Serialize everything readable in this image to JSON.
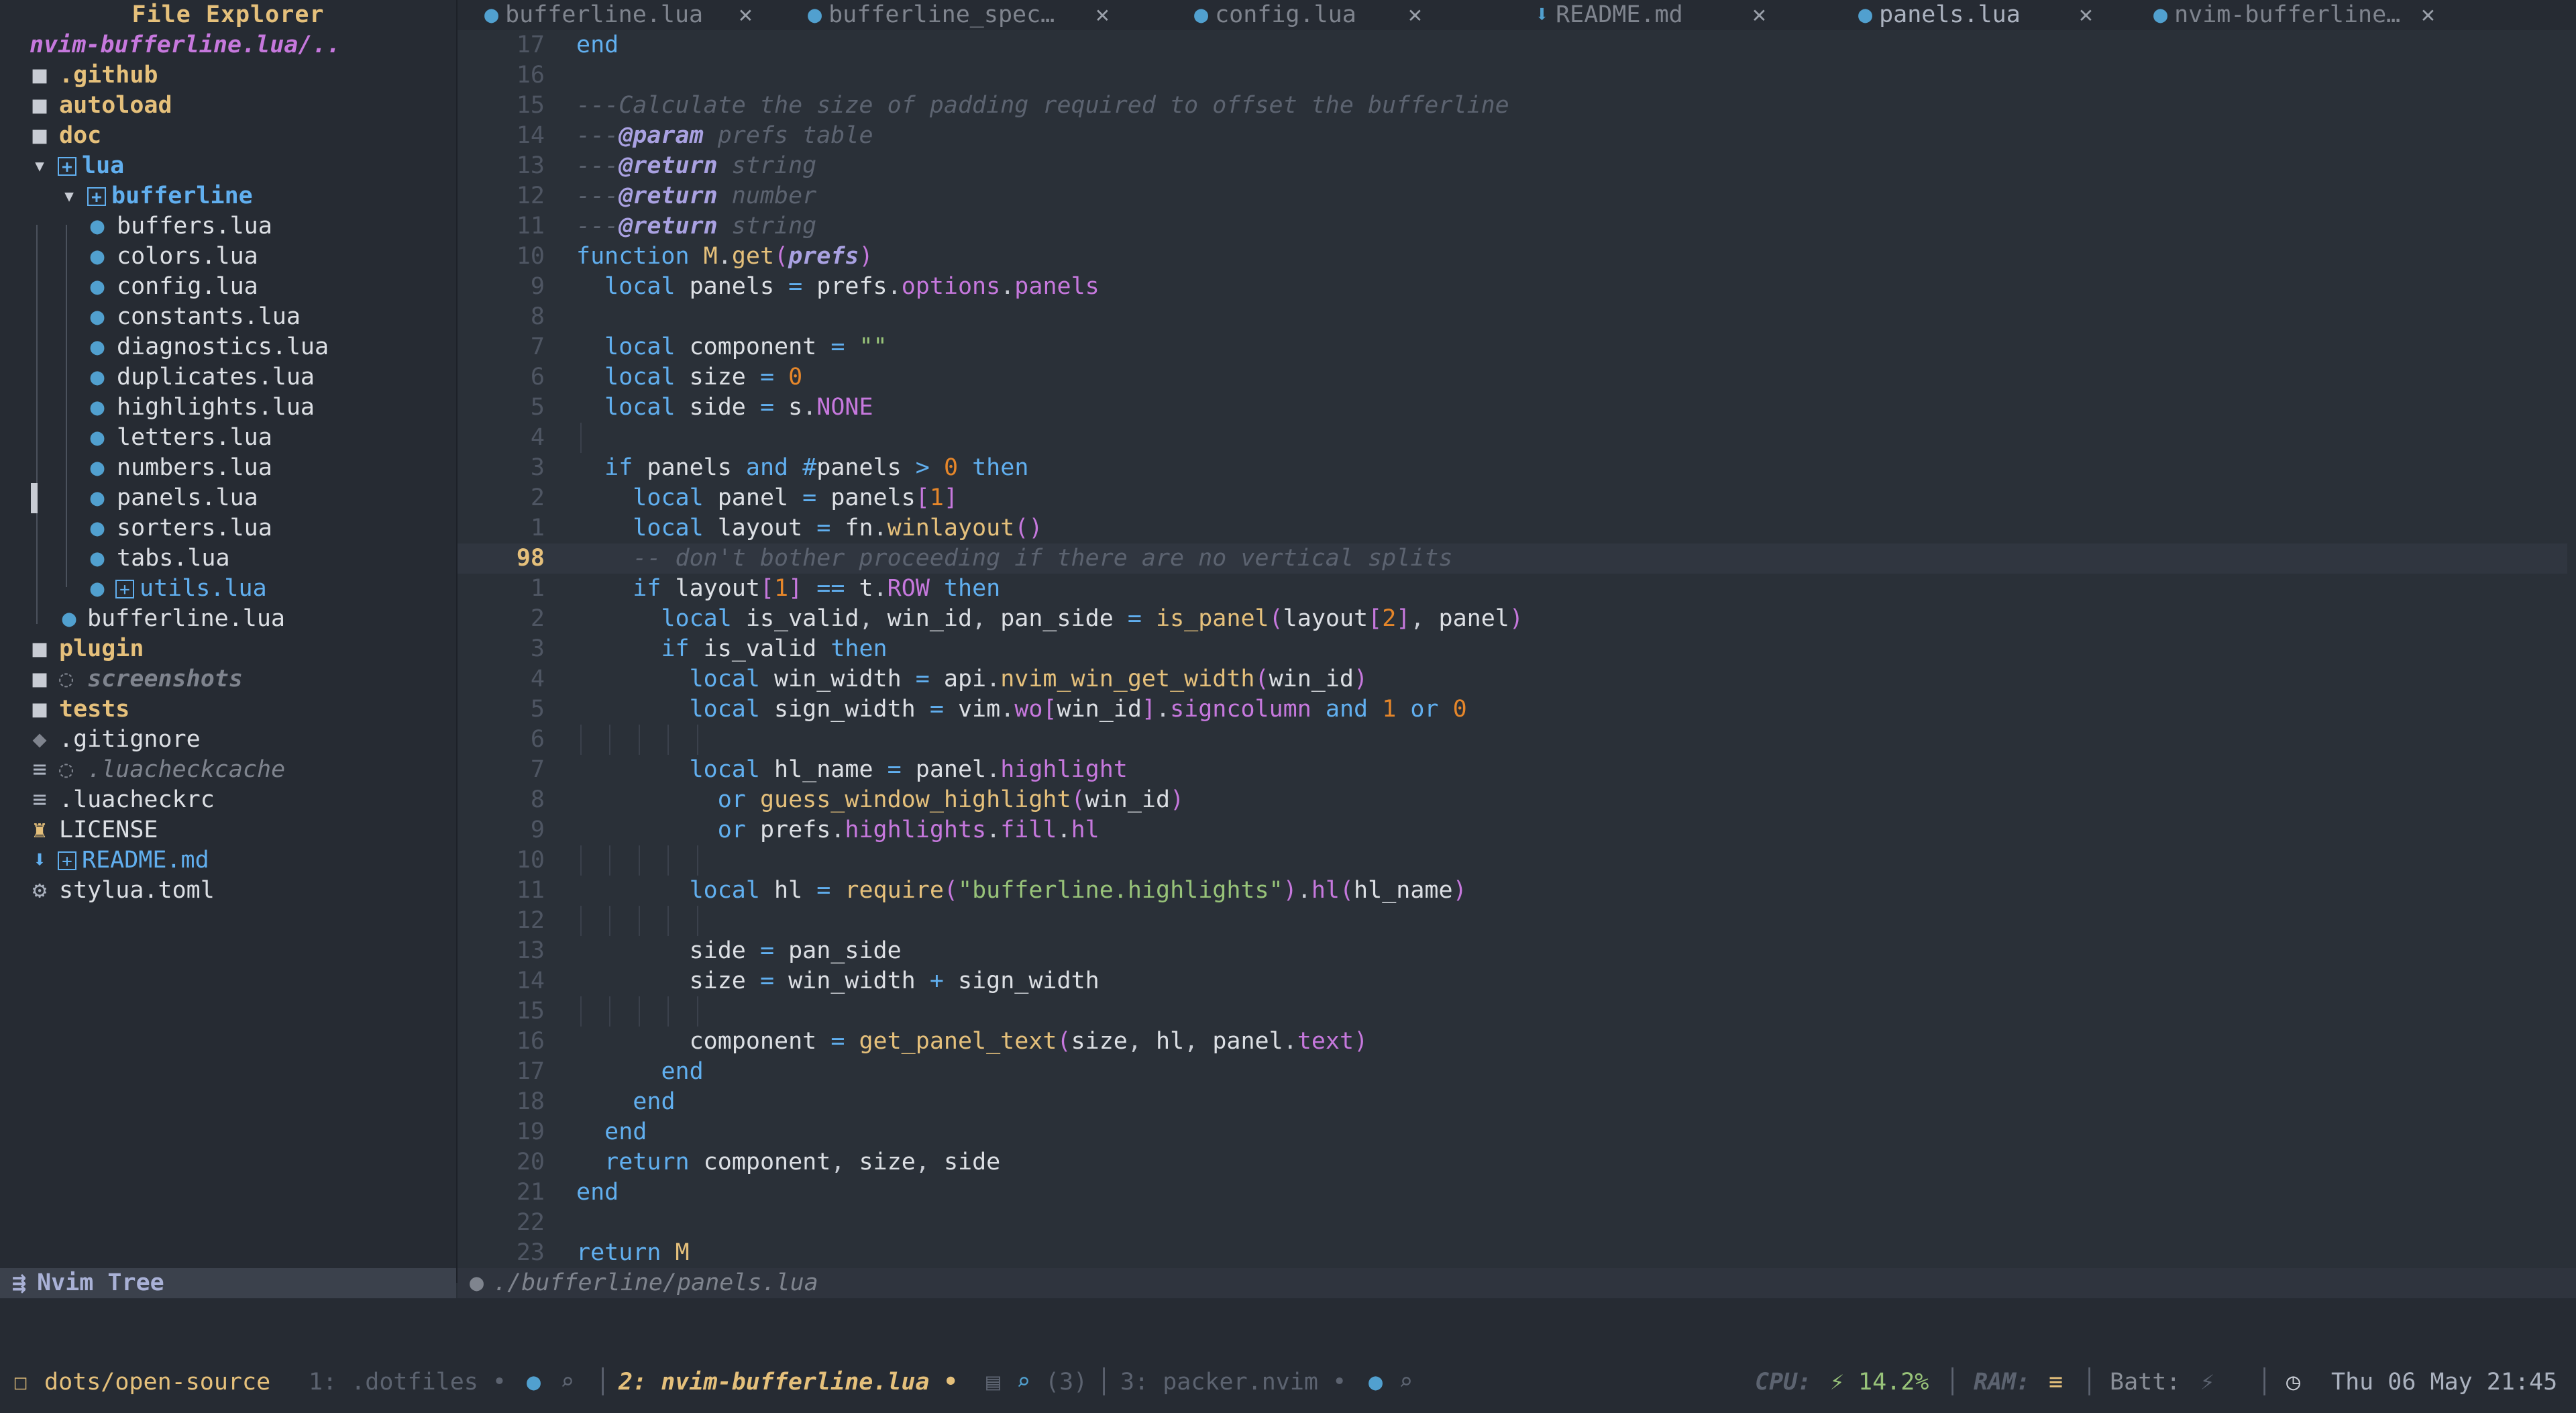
{
  "sidebar": {
    "title": "File Explorer",
    "root_path": "nvim-bufferline.lua/..",
    "items": [
      {
        "name": ".github",
        "kind": "folder"
      },
      {
        "name": "autoload",
        "kind": "folder"
      },
      {
        "name": "doc",
        "kind": "folder"
      },
      {
        "name": "lua",
        "kind": "folder-open"
      },
      {
        "name": "bufferline",
        "kind": "folder-open"
      },
      {
        "name": "buffers.lua",
        "kind": "lua"
      },
      {
        "name": "colors.lua",
        "kind": "lua"
      },
      {
        "name": "config.lua",
        "kind": "lua"
      },
      {
        "name": "constants.lua",
        "kind": "lua"
      },
      {
        "name": "diagnostics.lua",
        "kind": "lua"
      },
      {
        "name": "duplicates.lua",
        "kind": "lua"
      },
      {
        "name": "highlights.lua",
        "kind": "lua"
      },
      {
        "name": "letters.lua",
        "kind": "lua"
      },
      {
        "name": "numbers.lua",
        "kind": "lua"
      },
      {
        "name": "panels.lua",
        "kind": "lua"
      },
      {
        "name": "sorters.lua",
        "kind": "lua"
      },
      {
        "name": "tabs.lua",
        "kind": "lua"
      },
      {
        "name": "utils.lua",
        "kind": "lua-git"
      },
      {
        "name": "bufferline.lua",
        "kind": "lua"
      },
      {
        "name": "plugin",
        "kind": "folder"
      },
      {
        "name": "screenshots",
        "kind": "folder-ignored"
      },
      {
        "name": "tests",
        "kind": "folder"
      },
      {
        "name": ".gitignore",
        "kind": "git"
      },
      {
        "name": ".luacheckcache",
        "kind": "text-ignored"
      },
      {
        "name": ".luacheckrc",
        "kind": "text"
      },
      {
        "name": "LICENSE",
        "kind": "license"
      },
      {
        "name": "README.md",
        "kind": "markdown-git"
      },
      {
        "name": "stylua.toml",
        "kind": "config"
      }
    ],
    "statusline_label": "Nvim Tree"
  },
  "tabs": [
    {
      "label": "bufferline.lua",
      "close": "✕"
    },
    {
      "label": "bufferline_spec…",
      "close": "✕"
    },
    {
      "label": "config.lua",
      "close": "✕"
    },
    {
      "label": "README.md",
      "close": "✕"
    },
    {
      "label": "panels.lua",
      "close": "✕"
    },
    {
      "label": "nvim-bufferline…",
      "close": "✕"
    }
  ],
  "editor": {
    "line_numbers": [
      "17",
      "16",
      "15",
      "14",
      "13",
      "12",
      "11",
      "10",
      "9",
      "8",
      "7",
      "6",
      "5",
      "4",
      "3",
      "2",
      "1",
      "98",
      "1",
      "2",
      "3",
      "4",
      "5",
      "6",
      "7",
      "8",
      "9",
      "10",
      "11",
      "12",
      "13",
      "14",
      "15",
      "16",
      "17",
      "18",
      "19",
      "20",
      "21",
      "22",
      "23"
    ],
    "current_line_number": "98",
    "code": [
      "end",
      "",
      "---Calculate the size of padding required to offset the bufferline",
      "---@param prefs table",
      "---@return string",
      "---@return number",
      "---@return string",
      "function M.get(prefs)",
      "  local panels = prefs.options.panels",
      "",
      "  local component = \"\"",
      "  local size = 0",
      "  local side = s.NONE",
      "",
      "  if panels and #panels > 0 then",
      "    local panel = panels[1]",
      "    local layout = fn.winlayout()",
      "    -- don't bother proceeding if there are no vertical splits",
      "    if layout[1] == t.ROW then",
      "      local is_valid, win_id, pan_side = is_panel(layout[2], panel)",
      "      if is_valid then",
      "        local win_width = api.nvim_win_get_width(win_id)",
      "        local sign_width = vim.wo[win_id].signcolumn and 1 or 0",
      "",
      "        local hl_name = panel.highlight",
      "          or guess_window_highlight(win_id)",
      "          or prefs.highlights.fill.hl",
      "",
      "        local hl = require(\"bufferline.highlights\").hl(hl_name)",
      "",
      "        side = pan_side",
      "        size = win_width + sign_width",
      "",
      "        component = get_panel_text(size, hl, panel.text)",
      "      end",
      "    end",
      "  end",
      "  return component, size, side",
      "end",
      "",
      "return M"
    ],
    "statusline_path": "./bufferline/panels.lua"
  },
  "tmux": {
    "session": "dots/open-source",
    "windows": [
      {
        "label": "1: .dotfiles •"
      },
      {
        "label": "2: nvim-bufferline.lua •"
      },
      {
        "label": "3: packer.nvim •"
      }
    ],
    "active_extra": "(3)",
    "cpu_label": "CPU:",
    "cpu_value": "14.2%",
    "ram_label": "RAM:",
    "batt_label": "Batt:",
    "datetime": "Thu 06 May 21:45"
  }
}
